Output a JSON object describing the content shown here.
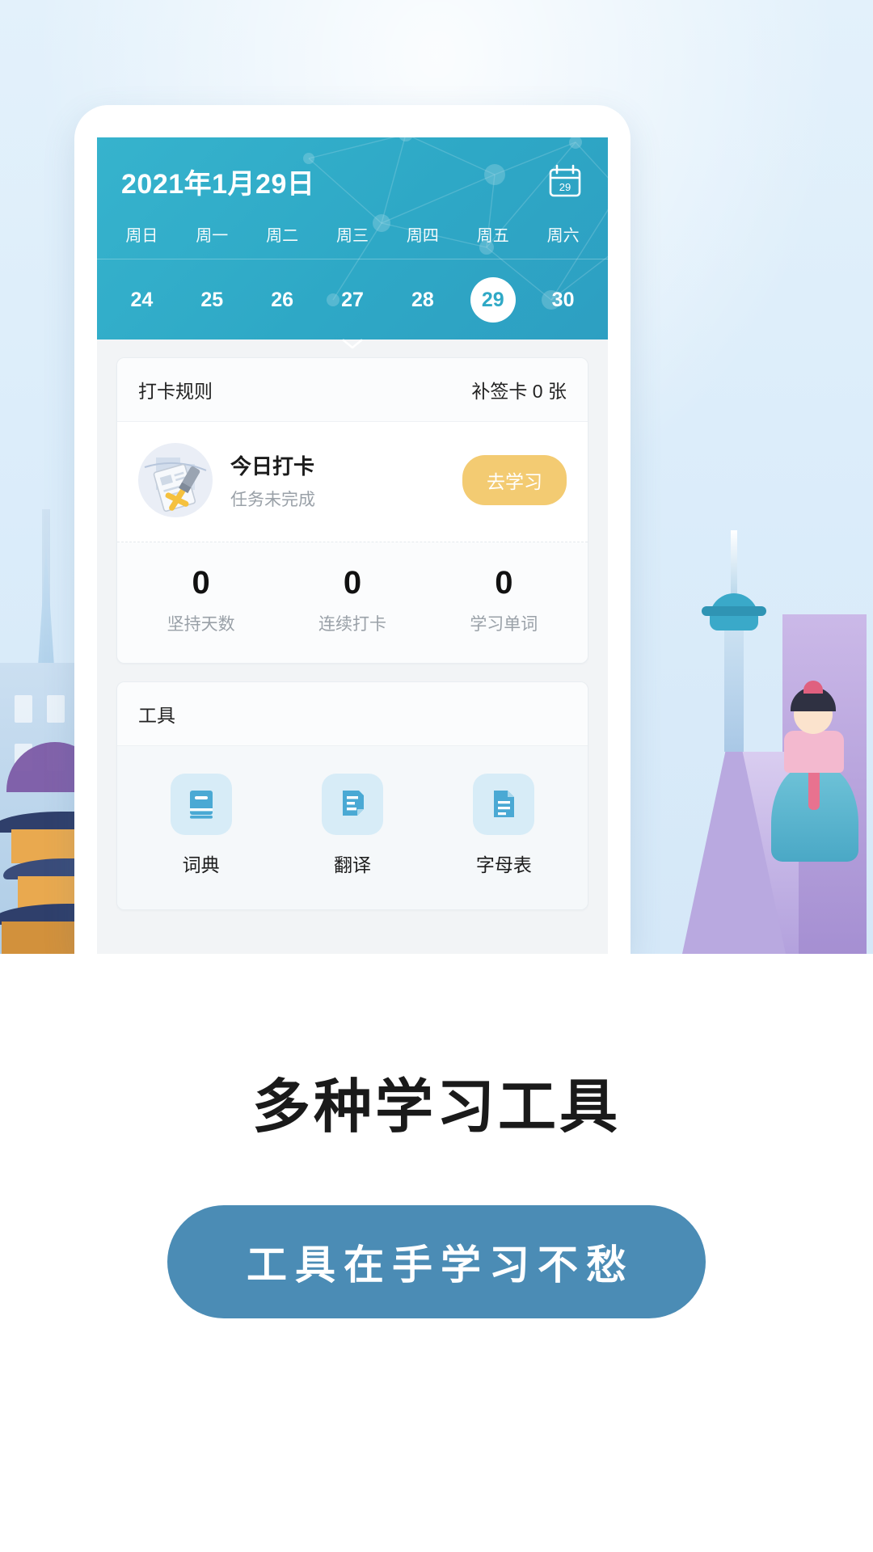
{
  "app": {
    "calendar": {
      "title": "2021年1月29日",
      "calendar_icon_day": "29",
      "weekdays": [
        "周日",
        "周一",
        "周二",
        "周三",
        "周四",
        "周五",
        "周六"
      ],
      "dates": [
        "24",
        "25",
        "26",
        "27",
        "28",
        "29",
        "30"
      ],
      "selected_date": "29",
      "expand_icon": "chevron-down-icon",
      "accent_color": "#2fa9c6"
    },
    "checkin_card": {
      "rules_label": "打卡规则",
      "makeup_cards_label": "补签卡 0 张",
      "title": "今日打卡",
      "subtitle": "任务未完成",
      "action_label": "去学习",
      "action_color": "#f3cb72",
      "stats": [
        {
          "value": "0",
          "label": "坚持天数"
        },
        {
          "value": "0",
          "label": "连续打卡"
        },
        {
          "value": "0",
          "label": "学习单词"
        }
      ]
    },
    "tools_card": {
      "header": "工具",
      "items": [
        {
          "label": "词典",
          "icon": "book-icon"
        },
        {
          "label": "翻译",
          "icon": "translate-document-icon"
        },
        {
          "label": "字母表",
          "icon": "document-lines-icon"
        }
      ],
      "icon_color": "#4aa9d4",
      "icon_bg_color": "#d7ecf7"
    }
  },
  "promo": {
    "headline": "多种学习工具",
    "button_label": "工具在手学习不愁",
    "button_color": "#4b8cb5"
  }
}
